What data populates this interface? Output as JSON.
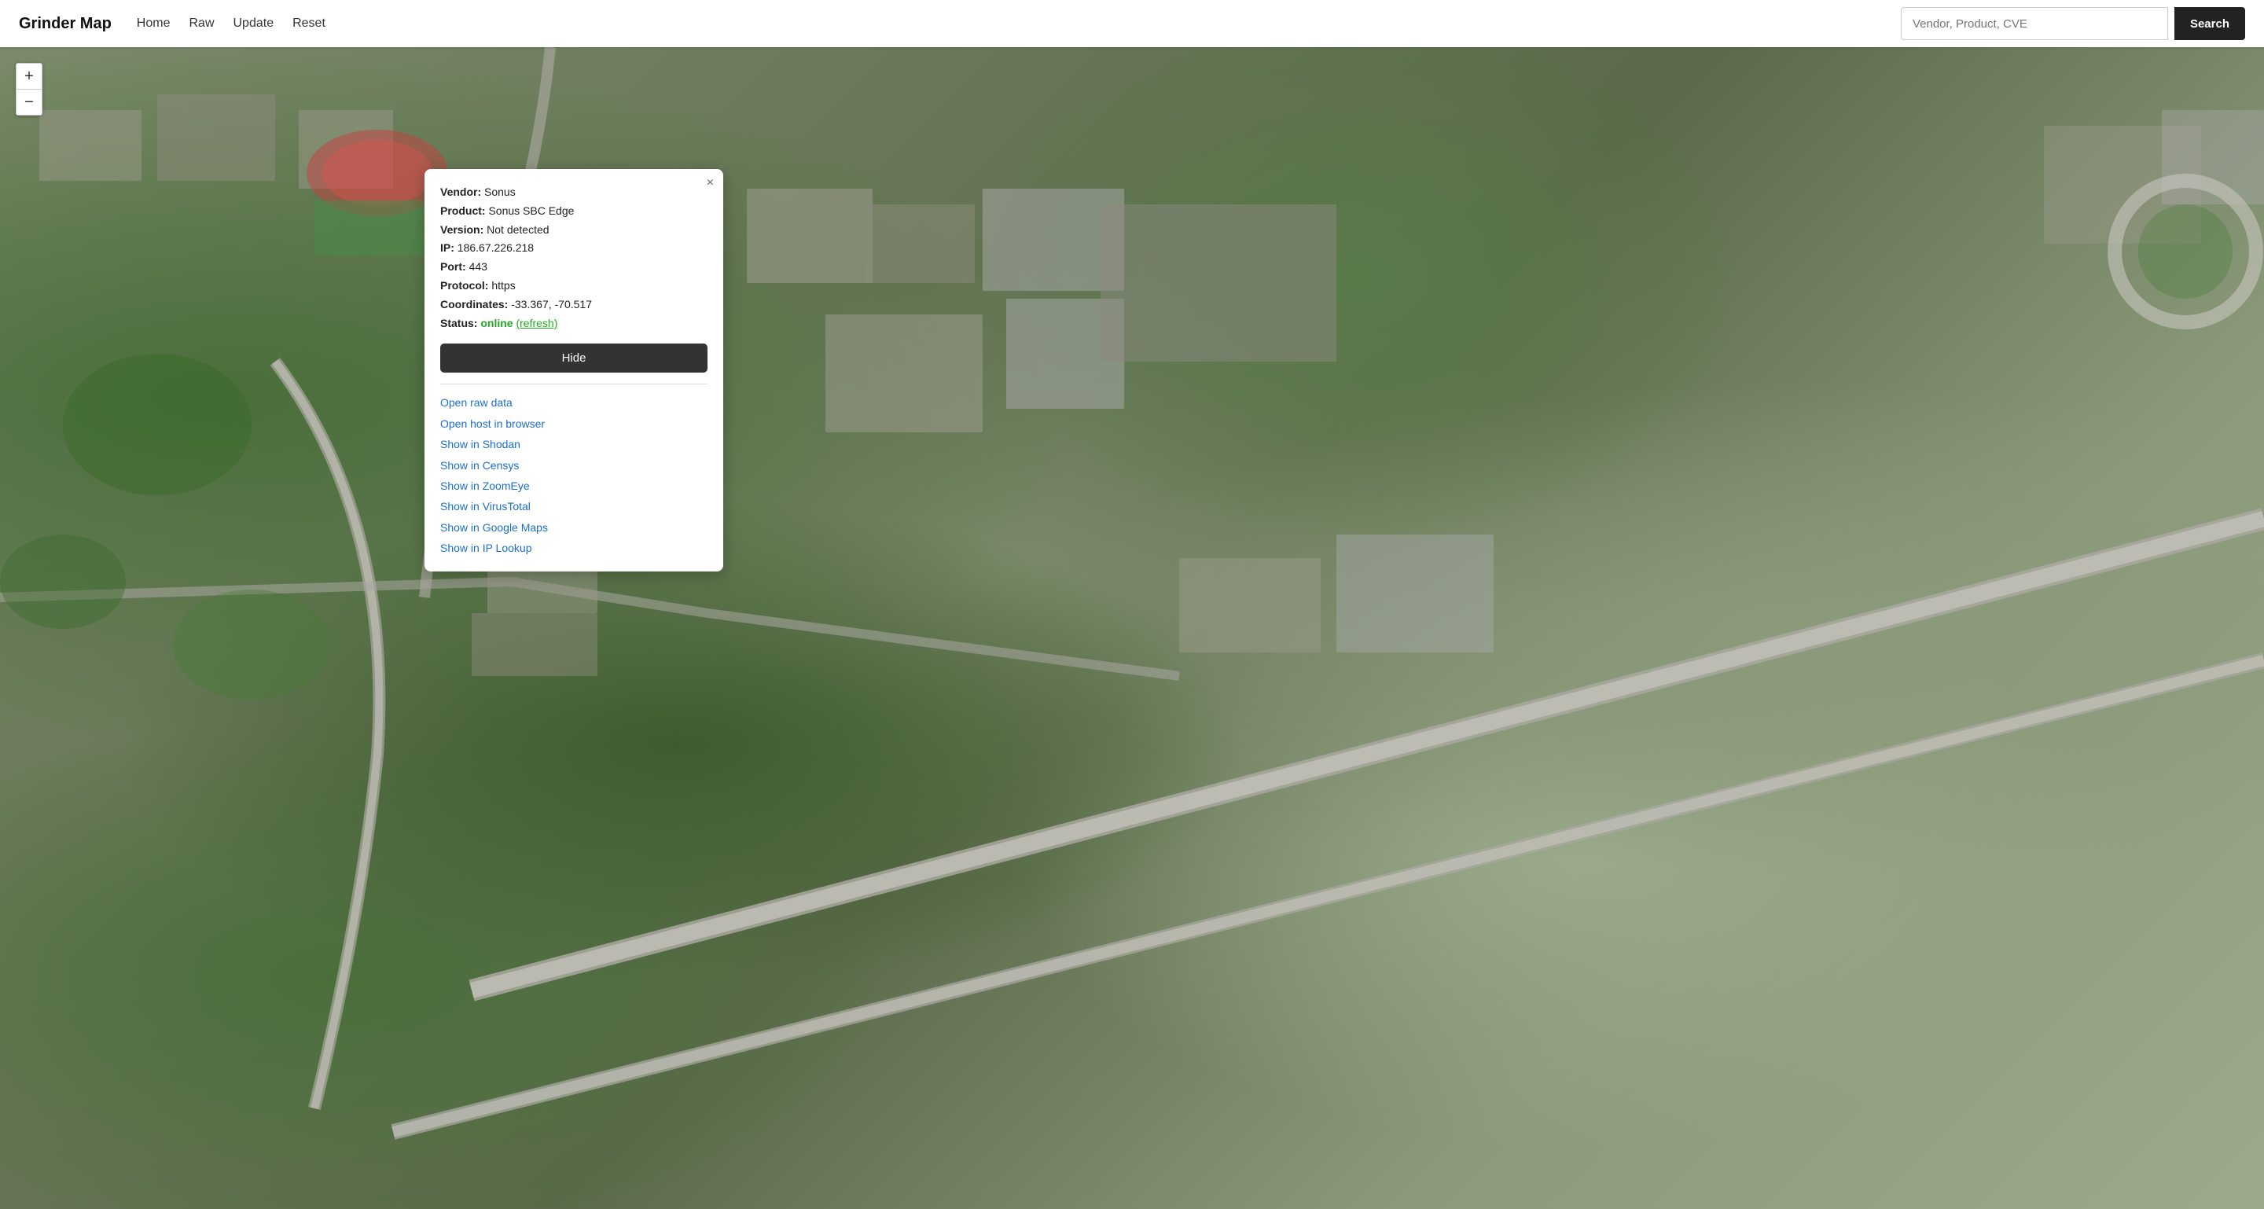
{
  "app": {
    "brand": "Grinder Map",
    "nav": {
      "links": [
        "Home",
        "Raw",
        "Update",
        "Reset"
      ]
    },
    "search": {
      "placeholder": "Vendor, Product, CVE",
      "button_label": "Search"
    }
  },
  "map_controls": {
    "zoom_in": "+",
    "zoom_out": "−"
  },
  "popup": {
    "close": "×",
    "vendor_label": "Vendor:",
    "vendor_value": "Sonus",
    "product_label": "Product:",
    "product_value": "Sonus SBC Edge",
    "version_label": "Version:",
    "version_value": "Not detected",
    "ip_label": "IP:",
    "ip_value": "186.67.226.218",
    "port_label": "Port:",
    "port_value": "443",
    "protocol_label": "Protocol:",
    "protocol_value": "https",
    "coordinates_label": "Coordinates:",
    "coordinates_value": "-33.367, -70.517",
    "status_label": "Status:",
    "status_value": "online",
    "refresh_label": "(refresh)",
    "hide_button": "Hide",
    "links": [
      "Open raw data",
      "Open host in browser",
      "Show in Shodan",
      "Show in Censys",
      "Show in ZoomEye",
      "Show in VirusTotal",
      "Show in Google Maps",
      "Show in IP Lookup"
    ]
  }
}
